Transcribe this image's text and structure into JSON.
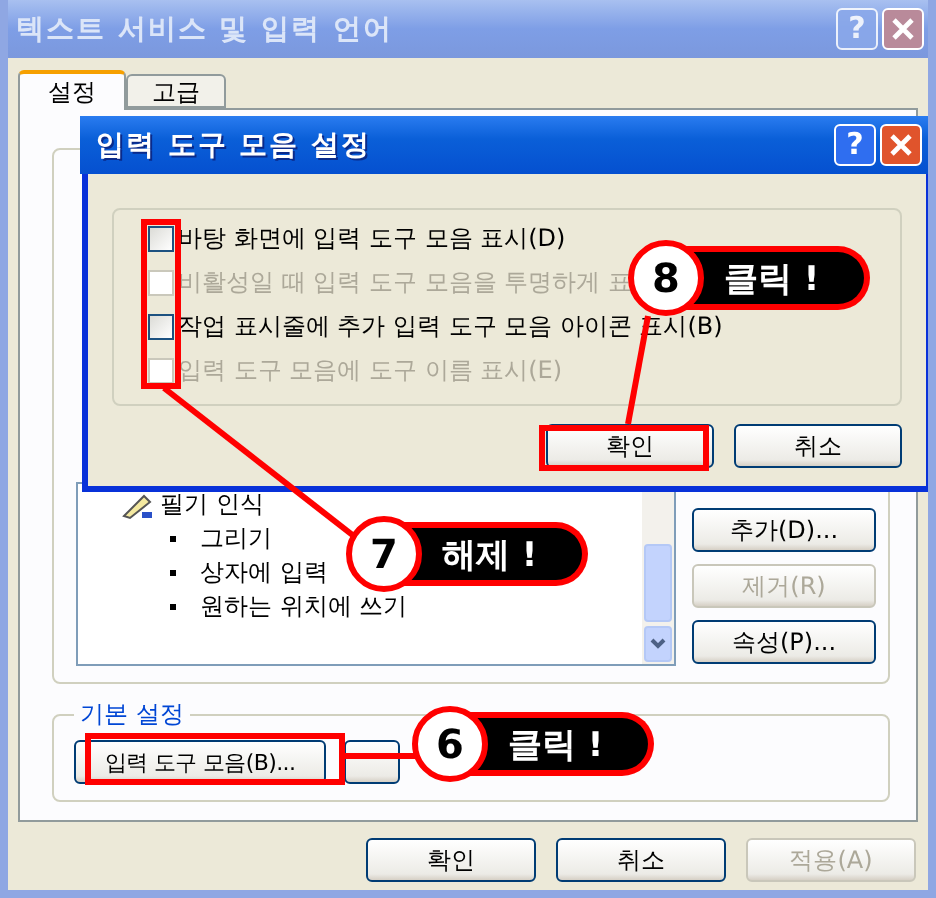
{
  "window": {
    "title": "텍스트 서비스 및 입력 언어",
    "help_button": "?"
  },
  "tabs": [
    {
      "label": "설정",
      "selected": true
    },
    {
      "label": "고급",
      "selected": false
    }
  ],
  "services": {
    "items": [
      {
        "label": "필기 인식",
        "children": [
          {
            "label": "그리기"
          },
          {
            "label": "상자에 입력"
          },
          {
            "label": "원하는 위치에 쓰기"
          }
        ]
      }
    ],
    "buttons": [
      {
        "label": "추가(D)...",
        "disabled": false
      },
      {
        "label": "제거(R)",
        "disabled": true
      },
      {
        "label": "속성(P)...",
        "disabled": false
      }
    ]
  },
  "preferences": {
    "title": "기본 설정",
    "button": "입력 도구 모음(B)..."
  },
  "footer_buttons": [
    {
      "label": "확인",
      "disabled": false
    },
    {
      "label": "취소",
      "disabled": false
    },
    {
      "label": "적용(A)",
      "disabled": true
    }
  ],
  "dialog": {
    "title": "입력 도구 모음 설정",
    "help_button": "?",
    "options": [
      {
        "label": "바탕 화면에 입력 도구 모음 표시(D)",
        "checked": false,
        "disabled": false
      },
      {
        "label": "비활성일 때 입력 도구 모음을 투명하게 표",
        "checked": false,
        "disabled": true
      },
      {
        "label": "작업 표시줄에 추가 입력 도구 모음 아이콘 표시(B)",
        "checked": false,
        "disabled": false
      },
      {
        "label": "입력 도구 모음에 도구 이름 표시(E)",
        "checked": false,
        "disabled": true
      }
    ],
    "buttons": [
      {
        "label": "확인"
      },
      {
        "label": "취소"
      }
    ]
  },
  "callouts": [
    {
      "number": "8",
      "text": "클릭 !"
    },
    {
      "number": "7",
      "text": "해제 !"
    },
    {
      "number": "6",
      "text": "클릭 !"
    }
  ]
}
